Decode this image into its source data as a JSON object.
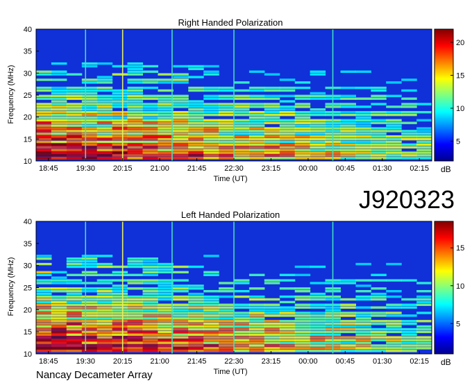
{
  "figure": {
    "id_label": "J920323",
    "footer": "Nancay Decameter Array"
  },
  "chart_data": [
    {
      "type": "heatmap",
      "title": "Right Handed Polarization",
      "xlabel": "Time (UT)",
      "ylabel": "Frequency (MHz)",
      "x_ticks": [
        "18:45",
        "19:30",
        "20:15",
        "21:00",
        "21:45",
        "22:30",
        "23:15",
        "00:00",
        "00:45",
        "01:30",
        "02:15"
      ],
      "y_ticks": [
        10,
        15,
        20,
        25,
        30,
        35,
        40
      ],
      "ylim": [
        10,
        40
      ],
      "colorbar": {
        "label": "dB",
        "ticks": [
          5,
          10,
          15,
          20
        ],
        "range": [
          2,
          22
        ]
      },
      "vertical_markers_time": [
        "19:30",
        "20:15",
        "21:15",
        "22:30",
        "00:30"
      ]
    },
    {
      "type": "heatmap",
      "title": "Left Handed Polarization",
      "xlabel": "Time (UT)",
      "ylabel": "Frequency (MHz)",
      "x_ticks": [
        "18:45",
        "19:30",
        "20:15",
        "21:00",
        "21:45",
        "22:30",
        "23:15",
        "00:00",
        "00:45",
        "01:30",
        "02:15"
      ],
      "y_ticks": [
        10,
        15,
        20,
        25,
        30,
        35,
        40
      ],
      "ylim": [
        10,
        40
      ],
      "colorbar": {
        "label": "dB",
        "ticks": [
          5,
          10,
          15
        ],
        "range": [
          1,
          18.5
        ]
      },
      "vertical_markers_time": [
        "19:30",
        "20:15",
        "21:15",
        "22:30",
        "00:30"
      ]
    }
  ]
}
